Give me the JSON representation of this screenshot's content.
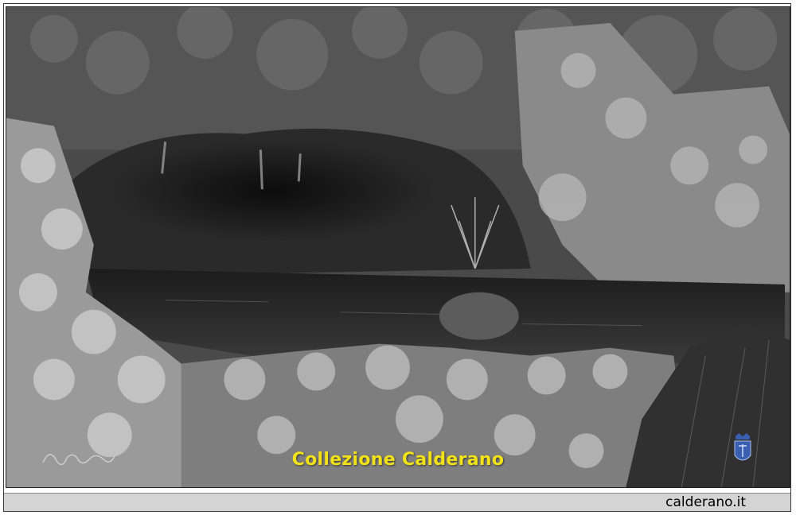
{
  "photo": {
    "caption": "Collezione Calderano",
    "signature_text": "Calderano"
  },
  "footer": {
    "site": "calderano.it"
  },
  "colors": {
    "caption": "#f2e21a",
    "footer_bg": "#d4d4d4"
  },
  "icons": {
    "crest": "crest-icon",
    "signature": "signature-icon"
  }
}
